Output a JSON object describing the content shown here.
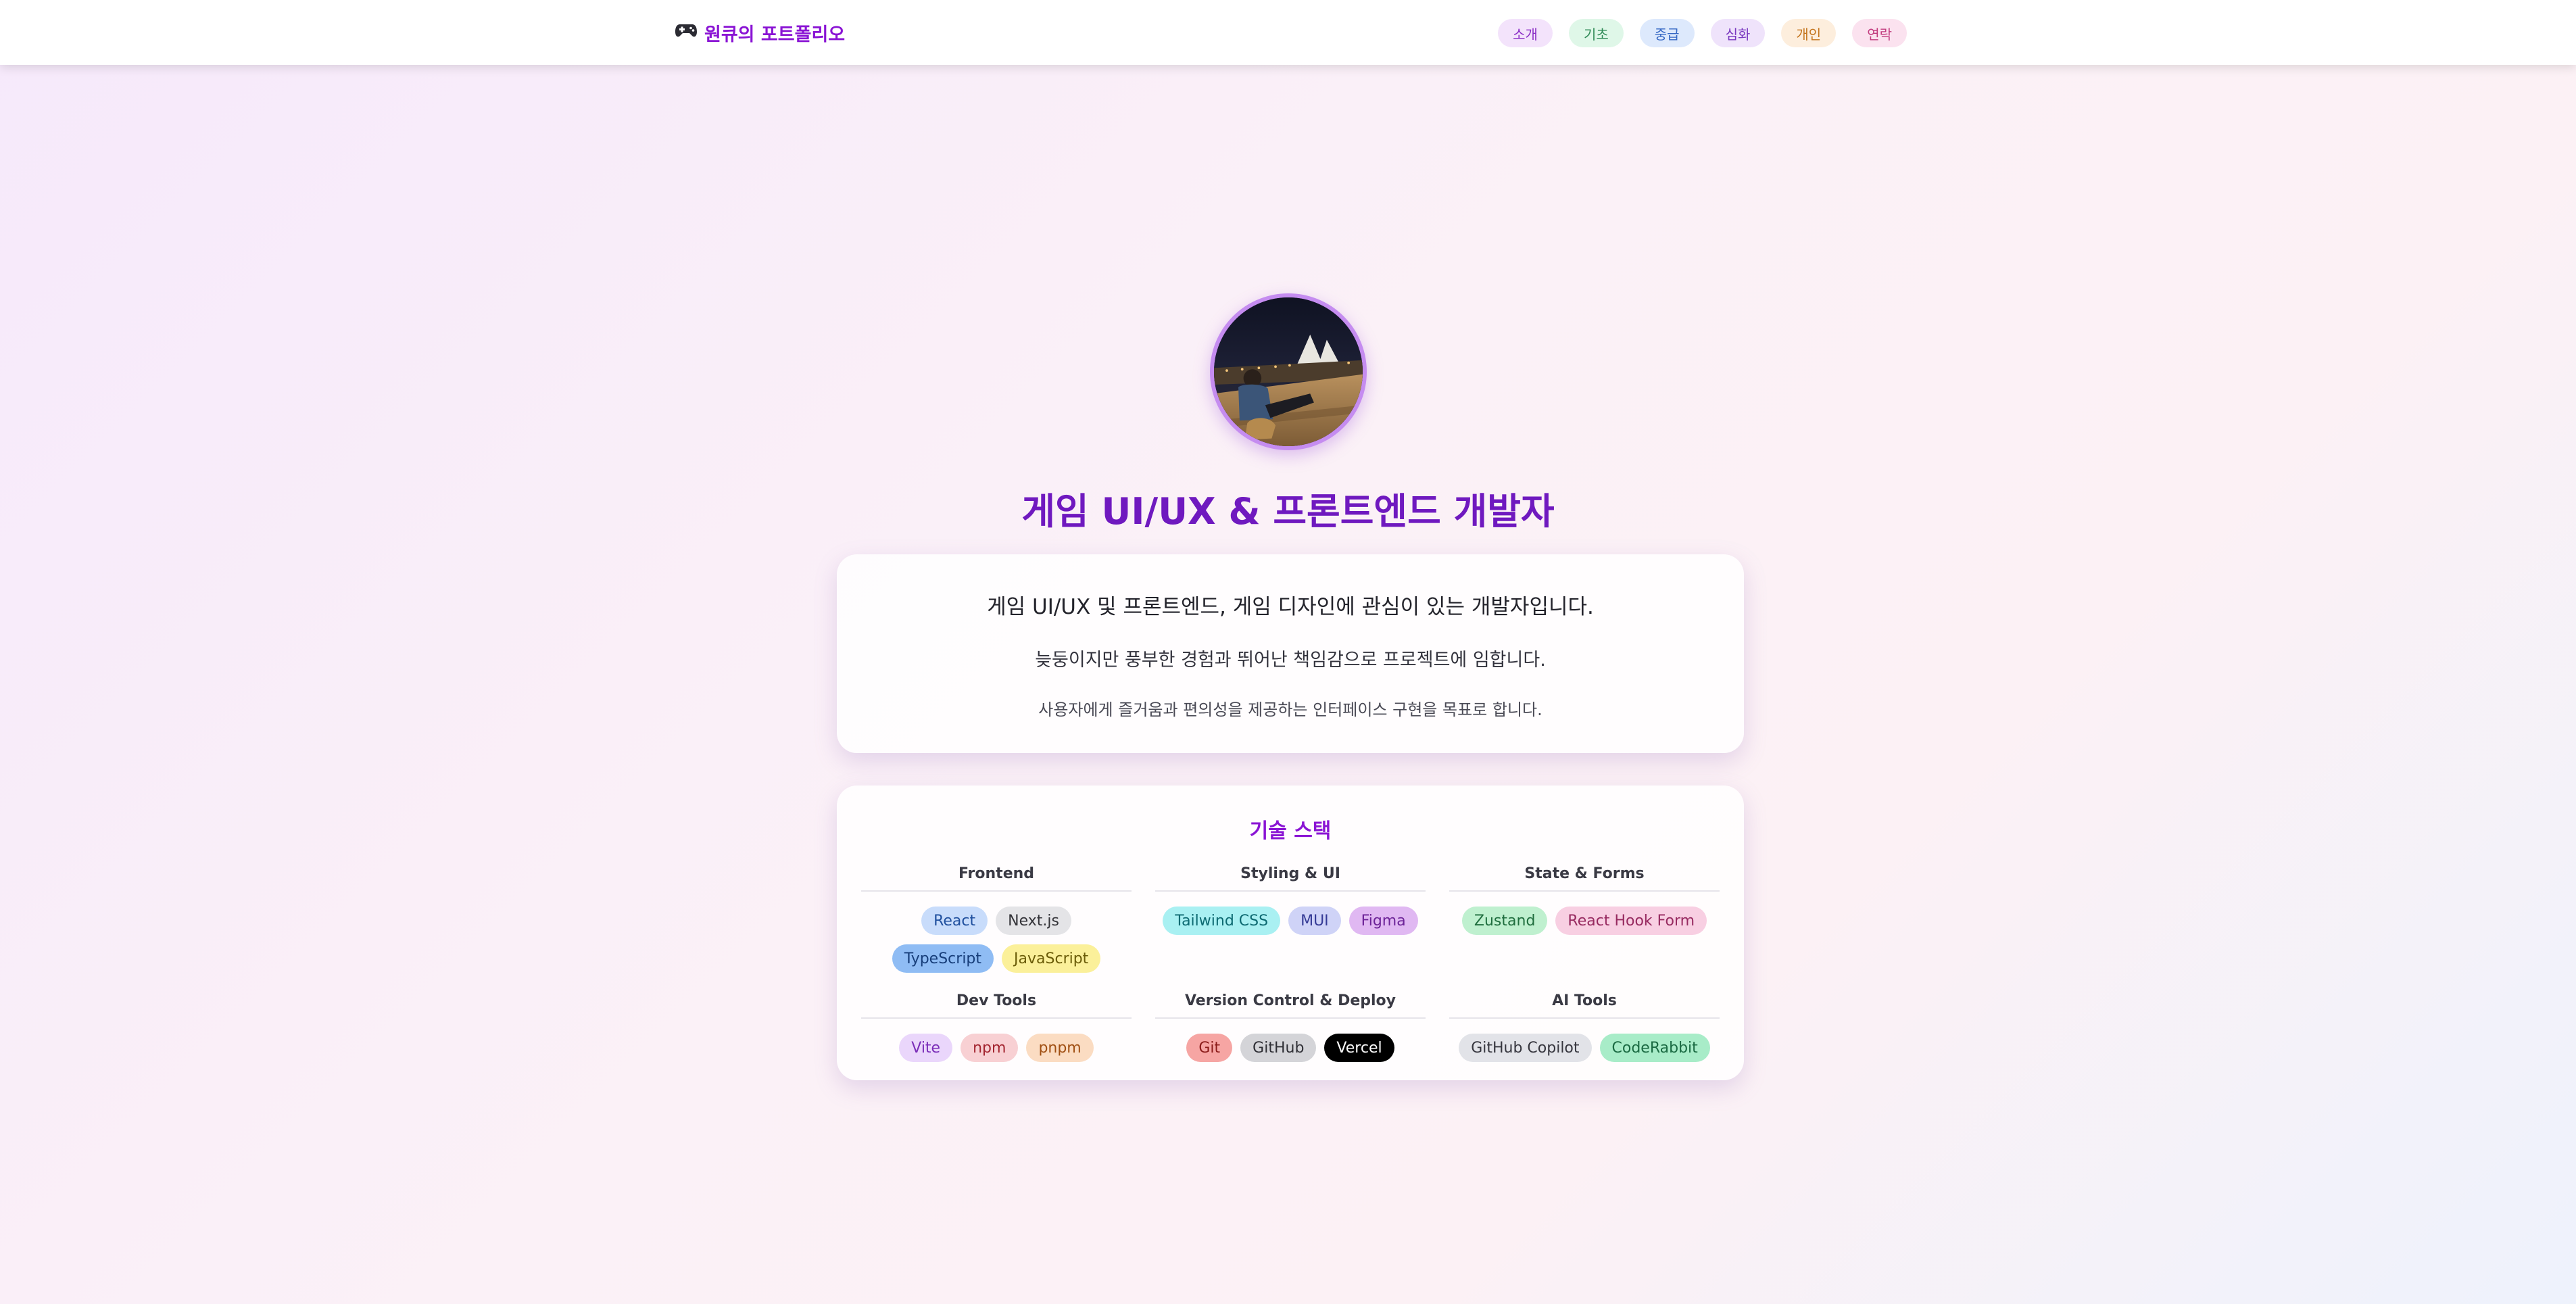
{
  "header": {
    "brand_icon": "gamepad-icon",
    "brand": "원큐의 포트폴리오",
    "nav": [
      {
        "label": "소개",
        "bg": "#f3e3fb",
        "color": "#8a2cc6"
      },
      {
        "label": "기초",
        "bg": "#dff7e8",
        "color": "#2f8a56"
      },
      {
        "label": "중급",
        "bg": "#dde9fc",
        "color": "#3668c4"
      },
      {
        "label": "심화",
        "bg": "#efe3fb",
        "color": "#7a38c0"
      },
      {
        "label": "개인",
        "bg": "#fdeedd",
        "color": "#c4741c"
      },
      {
        "label": "연락",
        "bg": "#fbe2ef",
        "color": "#c23b7e"
      }
    ]
  },
  "hero": {
    "title": "게임 UI/UX & 프론트엔드 개발자"
  },
  "intro": {
    "line1": "게임 UI/UX 및 프론트엔드, 게임 디자인에 관심이 있는 개발자입니다.",
    "line2": "늦둥이지만 풍부한 경험과 뛰어난 책임감으로 프로젝트에 임합니다.",
    "line3": "사용자에게 즐거움과 편의성을 제공하는 인터페이스 구현을 목표로 합니다."
  },
  "tech": {
    "title": "기술 스택",
    "groups": [
      {
        "title": "Frontend",
        "tags": [
          {
            "label": "React",
            "bg": "#c8dcfb",
            "color": "#1f4f9e"
          },
          {
            "label": "Next.js",
            "bg": "#e4e4e7",
            "color": "#333338"
          },
          {
            "label": "TypeScript",
            "bg": "#8fbcf4",
            "color": "#173e7a"
          },
          {
            "label": "JavaScript",
            "bg": "#fbf09a",
            "color": "#6b5c08"
          }
        ]
      },
      {
        "title": "Styling & UI",
        "tags": [
          {
            "label": "Tailwind CSS",
            "bg": "#a9f0f2",
            "color": "#0d6a72"
          },
          {
            "label": "MUI",
            "bg": "#cfd3f7",
            "color": "#353b96"
          },
          {
            "label": "Figma",
            "bg": "#e0b8f2",
            "color": "#6d2398"
          }
        ]
      },
      {
        "title": "State & Forms",
        "tags": [
          {
            "label": "Zustand",
            "bg": "#bff0cf",
            "color": "#1f6e3e"
          },
          {
            "label": "React Hook Form",
            "bg": "#f8cfe2",
            "color": "#972a60"
          }
        ]
      },
      {
        "title": "Dev Tools",
        "tags": [
          {
            "label": "Vite",
            "bg": "#ead6fb",
            "color": "#7a2cb8"
          },
          {
            "label": "npm",
            "bg": "#f8d0d3",
            "color": "#a3242f"
          },
          {
            "label": "pnpm",
            "bg": "#fbdcc2",
            "color": "#a04f12"
          }
        ]
      },
      {
        "title": "Version Control & Deploy",
        "tags": [
          {
            "label": "Git",
            "bg": "#f6a5a3",
            "color": "#8c1c1a"
          },
          {
            "label": "GitHub",
            "bg": "#d4d4d8",
            "color": "#2f2f35"
          },
          {
            "label": "Vercel",
            "bg": "#000000",
            "color": "#ffffff"
          }
        ]
      },
      {
        "title": "AI Tools",
        "tags": [
          {
            "label": "GitHub Copilot",
            "bg": "#e2e3e8",
            "color": "#36363e"
          },
          {
            "label": "CodeRabbit",
            "bg": "#a8ecc8",
            "color": "#1a6a42"
          }
        ]
      }
    ]
  }
}
